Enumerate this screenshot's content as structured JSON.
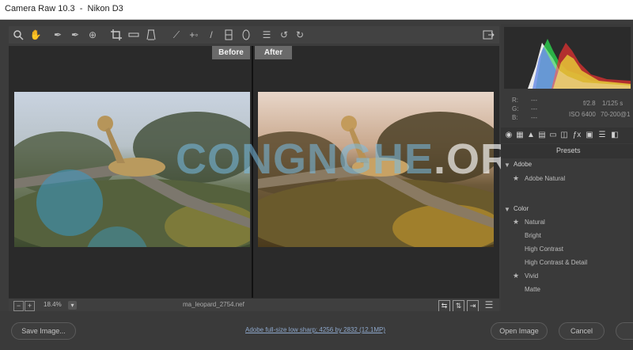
{
  "window": {
    "title": "Camera Raw 10.3  -  Nikon D3"
  },
  "toolbar": {
    "tools": [
      "zoom-tool",
      "hand-tool",
      "white-balance-tool",
      "color-sampler-tool",
      "target-adjustment-tool",
      "crop-tool",
      "straighten-tool",
      "transform-tool",
      "spot-removal-tool",
      "red-eye-tool",
      "adjustment-brush",
      "graduated-filter",
      "radial-filter",
      "preferences",
      "rotate-left",
      "rotate-right"
    ],
    "export_icon": "open-in-photoshop-icon"
  },
  "preview": {
    "before_label": "Before",
    "after_label": "After"
  },
  "bottombar": {
    "zoom_value": "18.4%",
    "filename": "ma_leopard_2754.nef"
  },
  "footer": {
    "save_label": "Save Image...",
    "info": "Adobe full-size low sharp; 4256 by 2832 (12.1MP)",
    "open_label": "Open Image",
    "cancel_label": "Cancel"
  },
  "camera_info": {
    "r_label": "R:",
    "g_label": "G:",
    "b_label": "B:",
    "r_value": "---",
    "g_value": "---",
    "b_value": "---",
    "aperture": "f/2.8",
    "shutter": "1/125 s",
    "iso": "ISO 6400",
    "lens": "70-200@1"
  },
  "panel": {
    "presets_title": "Presets",
    "groups": [
      {
        "name": "Adobe",
        "items": [
          "Adobe Natural"
        ]
      },
      {
        "name": "Color",
        "items": [
          "Natural",
          "Bright",
          "High Contrast",
          "High Contrast & Detail",
          "Vivid",
          "Matte"
        ]
      }
    ],
    "subitem": "Adobe Natural"
  },
  "watermark": {
    "main": "CONGNGHE",
    "suffix": ".ORG"
  },
  "colors": {
    "bg": "#3c3c3c",
    "panel": "#3a3a3a",
    "accent": "#8ea8cc"
  }
}
